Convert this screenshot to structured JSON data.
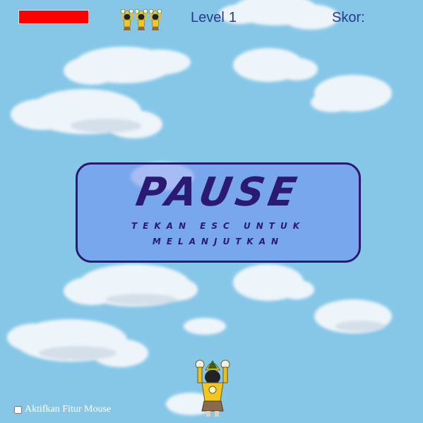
{
  "hud": {
    "health_level": 1.0,
    "health_color": "#ff0000",
    "lives_count": 3,
    "lives_icon": "wayang-figure-icon",
    "level_label": "Level",
    "level_value": "1",
    "score_label": "Skor:",
    "score_value": ""
  },
  "pause_overlay": {
    "title": "PAUSE",
    "subtitle": "TEKAN ESC UNTUK MELANJUTKAN"
  },
  "player": {
    "icon": "wayang-player-icon"
  },
  "mouse_option": {
    "label": "Aktifkan Fitur Mouse",
    "checked": false
  },
  "colors": {
    "sky": "#86c7e8",
    "text": "#283a8c",
    "panel_border": "#2a1a72"
  }
}
